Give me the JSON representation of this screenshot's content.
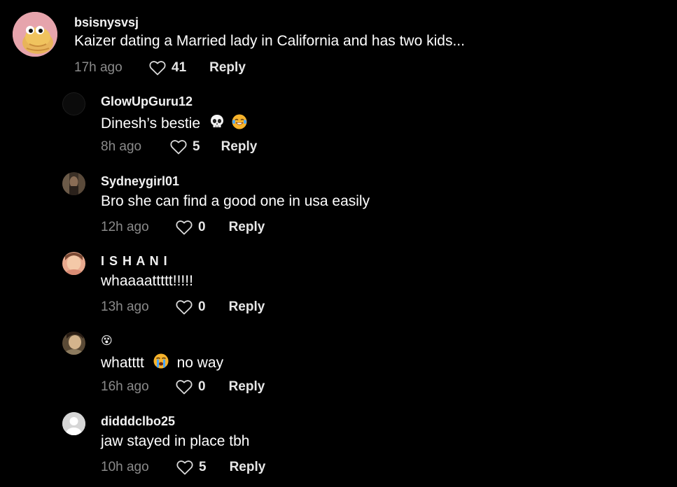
{
  "comments": [
    {
      "username": "bsisnysvsj",
      "text": "Kaizer dating a Married lady in California and has two kids...",
      "time": "17h ago",
      "likes": "41",
      "reply_label": "Reply",
      "avatar": "cartoon-creature-avatar"
    },
    {
      "username": "GlowUpGuru12",
      "text": "Dinesh’s bestie",
      "emojis": [
        "skull-emoji",
        "laughing-tears-emoji"
      ],
      "time": "8h ago",
      "likes": "5",
      "reply_label": "Reply",
      "avatar": "dark-avatar"
    },
    {
      "username": "Sydneygirl01",
      "text": "Bro she can find a good one in usa easily",
      "time": "12h ago",
      "likes": "0",
      "reply_label": "Reply",
      "avatar": "photo-avatar"
    },
    {
      "username": "I S H A N I",
      "text": "whaaaattttt!!!!!",
      "time": "13h ago",
      "likes": "0",
      "reply_label": "Reply",
      "avatar": "photo-avatar"
    },
    {
      "username": "😵",
      "text_before": "whatttt",
      "text_after": "no way",
      "emojis": [
        "crying-emoji"
      ],
      "time": "16h ago",
      "likes": "0",
      "reply_label": "Reply",
      "avatar": "photo-avatar"
    },
    {
      "username": "didddclbo25",
      "text": "jaw stayed in place tbh",
      "time": "10h ago",
      "likes": "5",
      "reply_label": "Reply",
      "avatar": "default-avatar"
    }
  ],
  "colors": {
    "background": "#000000",
    "text": "#ffffff",
    "muted": "#8a8a8a"
  }
}
